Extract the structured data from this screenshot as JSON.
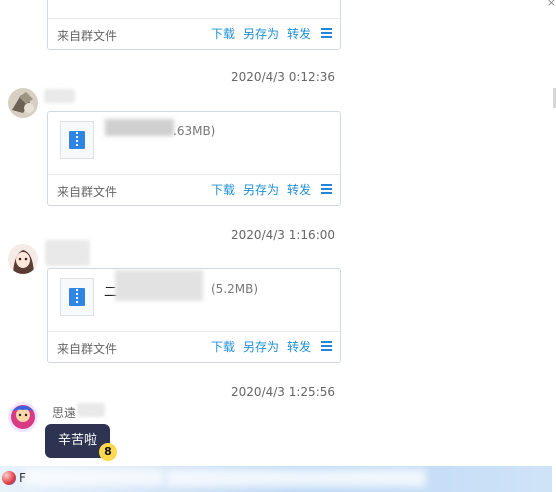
{
  "window": {
    "corner_close": "×"
  },
  "messages": [
    {
      "timestamp": "",
      "file_size": "",
      "footer": {
        "source": "来自群文件",
        "download": "下载",
        "save_as": "另存为",
        "forward": "转发"
      }
    },
    {
      "timestamp": "2020/4/3 0:12:36",
      "file_size": ".63MB)",
      "footer": {
        "source": "来自群文件",
        "download": "下载",
        "save_as": "另存为",
        "forward": "转发"
      }
    },
    {
      "timestamp": "2020/4/3 1:16:00",
      "file_name_char": "二",
      "file_size": "(5.2MB)",
      "footer": {
        "source": "来自群文件",
        "download": "下载",
        "save_as": "另存为",
        "forward": "转发"
      }
    },
    {
      "timestamp": "2020/4/3 1:25:56",
      "sender_name": "思遠",
      "bubble_text": "辛苦啦",
      "badge": "8"
    }
  ],
  "input_bar": {
    "prefix": "F"
  },
  "colors": {
    "accent_link": "#1e8fd6",
    "bubble_bg": "#2d3350",
    "file_icon": "#2e85e3",
    "input_bar": "#bcd8f5"
  }
}
